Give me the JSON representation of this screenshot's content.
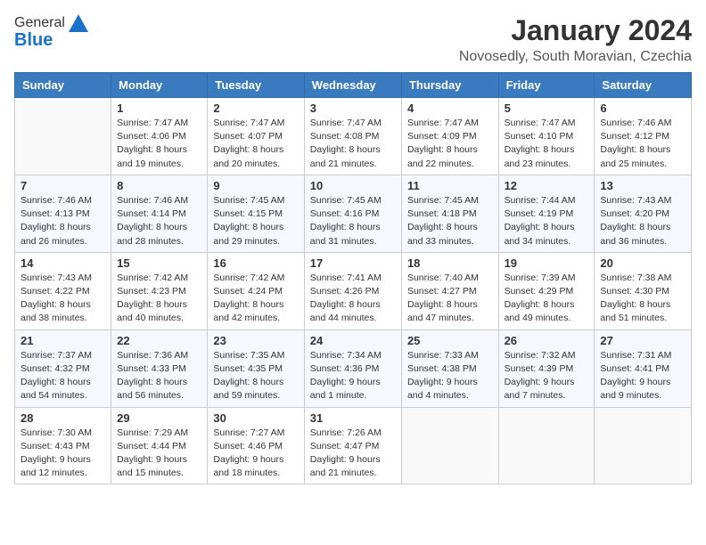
{
  "header": {
    "logo_general": "General",
    "logo_blue": "Blue",
    "month_year": "January 2024",
    "location": "Novosedly, South Moravian, Czechia"
  },
  "days_of_week": [
    "Sunday",
    "Monday",
    "Tuesday",
    "Wednesday",
    "Thursday",
    "Friday",
    "Saturday"
  ],
  "weeks": [
    [
      {
        "day": "",
        "sunrise": "",
        "sunset": "",
        "daylight": ""
      },
      {
        "day": "1",
        "sunrise": "Sunrise: 7:47 AM",
        "sunset": "Sunset: 4:06 PM",
        "daylight": "Daylight: 8 hours and 19 minutes."
      },
      {
        "day": "2",
        "sunrise": "Sunrise: 7:47 AM",
        "sunset": "Sunset: 4:07 PM",
        "daylight": "Daylight: 8 hours and 20 minutes."
      },
      {
        "day": "3",
        "sunrise": "Sunrise: 7:47 AM",
        "sunset": "Sunset: 4:08 PM",
        "daylight": "Daylight: 8 hours and 21 minutes."
      },
      {
        "day": "4",
        "sunrise": "Sunrise: 7:47 AM",
        "sunset": "Sunset: 4:09 PM",
        "daylight": "Daylight: 8 hours and 22 minutes."
      },
      {
        "day": "5",
        "sunrise": "Sunrise: 7:47 AM",
        "sunset": "Sunset: 4:10 PM",
        "daylight": "Daylight: 8 hours and 23 minutes."
      },
      {
        "day": "6",
        "sunrise": "Sunrise: 7:46 AM",
        "sunset": "Sunset: 4:12 PM",
        "daylight": "Daylight: 8 hours and 25 minutes."
      }
    ],
    [
      {
        "day": "7",
        "sunrise": "Sunrise: 7:46 AM",
        "sunset": "Sunset: 4:13 PM",
        "daylight": "Daylight: 8 hours and 26 minutes."
      },
      {
        "day": "8",
        "sunrise": "Sunrise: 7:46 AM",
        "sunset": "Sunset: 4:14 PM",
        "daylight": "Daylight: 8 hours and 28 minutes."
      },
      {
        "day": "9",
        "sunrise": "Sunrise: 7:45 AM",
        "sunset": "Sunset: 4:15 PM",
        "daylight": "Daylight: 8 hours and 29 minutes."
      },
      {
        "day": "10",
        "sunrise": "Sunrise: 7:45 AM",
        "sunset": "Sunset: 4:16 PM",
        "daylight": "Daylight: 8 hours and 31 minutes."
      },
      {
        "day": "11",
        "sunrise": "Sunrise: 7:45 AM",
        "sunset": "Sunset: 4:18 PM",
        "daylight": "Daylight: 8 hours and 33 minutes."
      },
      {
        "day": "12",
        "sunrise": "Sunrise: 7:44 AM",
        "sunset": "Sunset: 4:19 PM",
        "daylight": "Daylight: 8 hours and 34 minutes."
      },
      {
        "day": "13",
        "sunrise": "Sunrise: 7:43 AM",
        "sunset": "Sunset: 4:20 PM",
        "daylight": "Daylight: 8 hours and 36 minutes."
      }
    ],
    [
      {
        "day": "14",
        "sunrise": "Sunrise: 7:43 AM",
        "sunset": "Sunset: 4:22 PM",
        "daylight": "Daylight: 8 hours and 38 minutes."
      },
      {
        "day": "15",
        "sunrise": "Sunrise: 7:42 AM",
        "sunset": "Sunset: 4:23 PM",
        "daylight": "Daylight: 8 hours and 40 minutes."
      },
      {
        "day": "16",
        "sunrise": "Sunrise: 7:42 AM",
        "sunset": "Sunset: 4:24 PM",
        "daylight": "Daylight: 8 hours and 42 minutes."
      },
      {
        "day": "17",
        "sunrise": "Sunrise: 7:41 AM",
        "sunset": "Sunset: 4:26 PM",
        "daylight": "Daylight: 8 hours and 44 minutes."
      },
      {
        "day": "18",
        "sunrise": "Sunrise: 7:40 AM",
        "sunset": "Sunset: 4:27 PM",
        "daylight": "Daylight: 8 hours and 47 minutes."
      },
      {
        "day": "19",
        "sunrise": "Sunrise: 7:39 AM",
        "sunset": "Sunset: 4:29 PM",
        "daylight": "Daylight: 8 hours and 49 minutes."
      },
      {
        "day": "20",
        "sunrise": "Sunrise: 7:38 AM",
        "sunset": "Sunset: 4:30 PM",
        "daylight": "Daylight: 8 hours and 51 minutes."
      }
    ],
    [
      {
        "day": "21",
        "sunrise": "Sunrise: 7:37 AM",
        "sunset": "Sunset: 4:32 PM",
        "daylight": "Daylight: 8 hours and 54 minutes."
      },
      {
        "day": "22",
        "sunrise": "Sunrise: 7:36 AM",
        "sunset": "Sunset: 4:33 PM",
        "daylight": "Daylight: 8 hours and 56 minutes."
      },
      {
        "day": "23",
        "sunrise": "Sunrise: 7:35 AM",
        "sunset": "Sunset: 4:35 PM",
        "daylight": "Daylight: 8 hours and 59 minutes."
      },
      {
        "day": "24",
        "sunrise": "Sunrise: 7:34 AM",
        "sunset": "Sunset: 4:36 PM",
        "daylight": "Daylight: 9 hours and 1 minute."
      },
      {
        "day": "25",
        "sunrise": "Sunrise: 7:33 AM",
        "sunset": "Sunset: 4:38 PM",
        "daylight": "Daylight: 9 hours and 4 minutes."
      },
      {
        "day": "26",
        "sunrise": "Sunrise: 7:32 AM",
        "sunset": "Sunset: 4:39 PM",
        "daylight": "Daylight: 9 hours and 7 minutes."
      },
      {
        "day": "27",
        "sunrise": "Sunrise: 7:31 AM",
        "sunset": "Sunset: 4:41 PM",
        "daylight": "Daylight: 9 hours and 9 minutes."
      }
    ],
    [
      {
        "day": "28",
        "sunrise": "Sunrise: 7:30 AM",
        "sunset": "Sunset: 4:43 PM",
        "daylight": "Daylight: 9 hours and 12 minutes."
      },
      {
        "day": "29",
        "sunrise": "Sunrise: 7:29 AM",
        "sunset": "Sunset: 4:44 PM",
        "daylight": "Daylight: 9 hours and 15 minutes."
      },
      {
        "day": "30",
        "sunrise": "Sunrise: 7:27 AM",
        "sunset": "Sunset: 4:46 PM",
        "daylight": "Daylight: 9 hours and 18 minutes."
      },
      {
        "day": "31",
        "sunrise": "Sunrise: 7:26 AM",
        "sunset": "Sunset: 4:47 PM",
        "daylight": "Daylight: 9 hours and 21 minutes."
      },
      {
        "day": "",
        "sunrise": "",
        "sunset": "",
        "daylight": ""
      },
      {
        "day": "",
        "sunrise": "",
        "sunset": "",
        "daylight": ""
      },
      {
        "day": "",
        "sunrise": "",
        "sunset": "",
        "daylight": ""
      }
    ]
  ]
}
